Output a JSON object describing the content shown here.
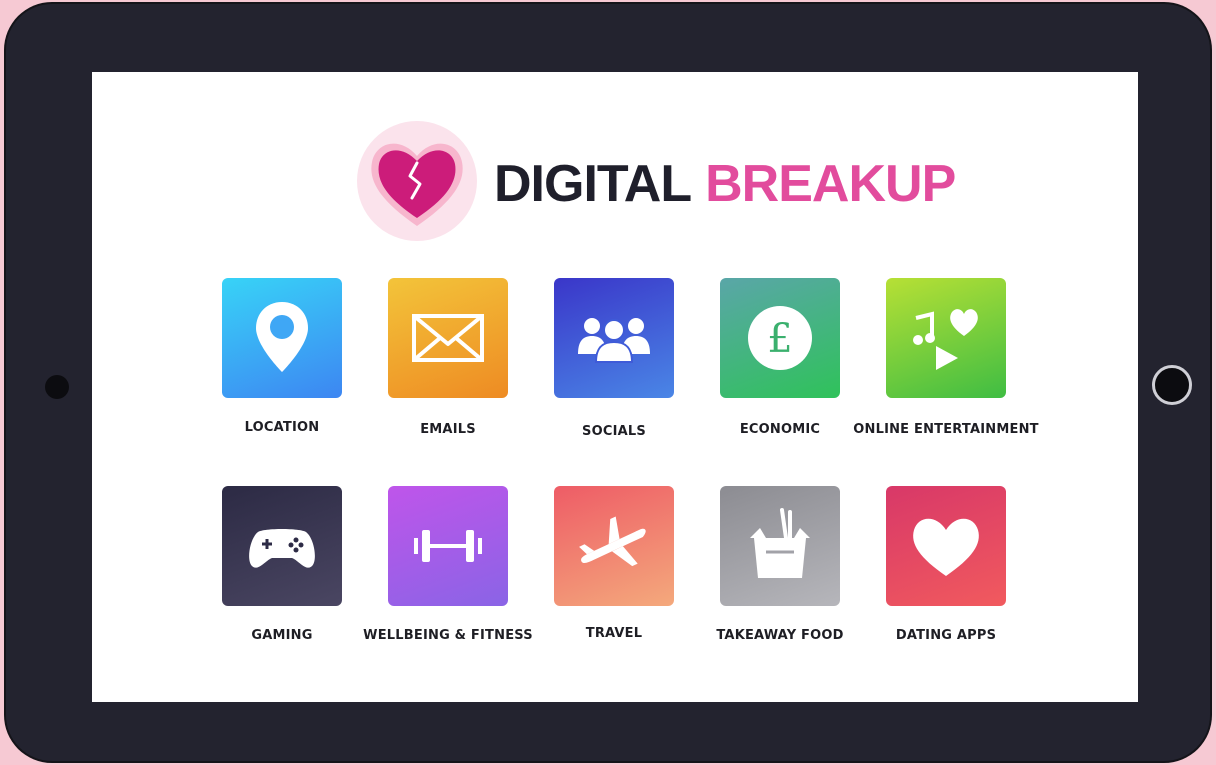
{
  "app": {
    "logo_word_1": "DIGITAL",
    "logo_word_2": "BREAKUP",
    "colors": {
      "frame": "#23232f",
      "accent_pink": "#e24c9d",
      "logo_dark": "#1f1f2b"
    }
  },
  "categories": [
    {
      "label": "LOCATION",
      "icon": "location-pin-icon",
      "gradient": [
        "#38d3f7",
        "#3d86f2"
      ]
    },
    {
      "label": "EMAILS",
      "icon": "envelope-icon",
      "gradient": [
        "#f3c43a",
        "#ee8b23"
      ]
    },
    {
      "label": "SOCIALS",
      "icon": "group-icon",
      "gradient": [
        "#3a36c9",
        "#4a86e6"
      ]
    },
    {
      "label": "ECONOMIC",
      "icon": "pound-coin-icon",
      "gradient": [
        "#5aa6a8",
        "#2fc25a"
      ]
    },
    {
      "label": "ONLINE ENTERTAINMENT",
      "icon": "media-icon",
      "gradient": [
        "#b7e035",
        "#3fbd43"
      ]
    },
    {
      "label": "GAMING",
      "icon": "gamepad-icon",
      "gradient": [
        "#2c2a44",
        "#4a4662"
      ]
    },
    {
      "label": "WELLBEING & FITNESS",
      "icon": "dumbbell-icon",
      "gradient": [
        "#bf55ea",
        "#8a64e6"
      ]
    },
    {
      "label": "TRAVEL",
      "icon": "airplane-icon",
      "gradient": [
        "#ee5c66",
        "#f4a97c"
      ]
    },
    {
      "label": "TAKEAWAY FOOD",
      "icon": "takeaway-box-icon",
      "gradient": [
        "#8c8c92",
        "#b6b6bb"
      ]
    },
    {
      "label": "DATING APPS",
      "icon": "heart-icon",
      "gradient": [
        "#d83868",
        "#f15a5e"
      ]
    }
  ]
}
